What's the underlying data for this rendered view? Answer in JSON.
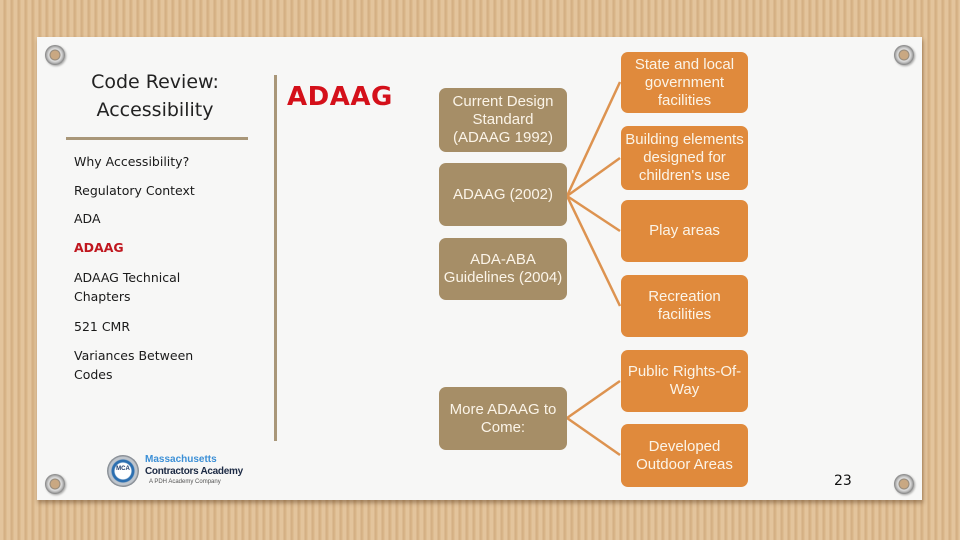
{
  "slide": {
    "title": "Code Review: Accessibility",
    "heading": "ADAAG",
    "page_number": "23",
    "accent_color": "#d4101a",
    "tan_color": "#a68e67",
    "orange_color": "#e08a3c"
  },
  "sidebar": {
    "items": [
      {
        "label": "Why Accessibility?",
        "active": false
      },
      {
        "label": "Regulatory Context",
        "active": false
      },
      {
        "label": "ADA",
        "active": false
      },
      {
        "label": "ADAAG",
        "active": true
      },
      {
        "label": "ADAAG Technical Chapters",
        "active": false
      },
      {
        "label": "521 CMR",
        "active": false
      },
      {
        "label": "Variances Between Codes",
        "active": false
      }
    ]
  },
  "diagram": {
    "left_nodes": [
      {
        "label": "Current Design Standard (ADAAG 1992)"
      },
      {
        "label": "ADAAG (2002)"
      },
      {
        "label": "ADA-ABA Guidelines (2004)"
      },
      {
        "label": "More ADAAG to Come:"
      }
    ],
    "right_nodes": [
      {
        "label": "State and local government facilities",
        "parent": "ADAAG (2002)"
      },
      {
        "label": "Building elements designed for children's use",
        "parent": "ADAAG (2002)"
      },
      {
        "label": "Play areas",
        "parent": "ADAAG (2002)"
      },
      {
        "label": "Recreation facilities",
        "parent": "ADAAG (2002)"
      },
      {
        "label": "Public Rights-Of-Way",
        "parent": "More ADAAG to Come:"
      },
      {
        "label": "Developed Outdoor Areas",
        "parent": "More ADAAG to Come:"
      }
    ]
  },
  "logo": {
    "line1": "Massachusetts",
    "line2": "Contractors Academy",
    "line3": "A PDH Academy Company",
    "badge": "MCA"
  },
  "icons": {
    "grommet": "grommet-icon"
  }
}
